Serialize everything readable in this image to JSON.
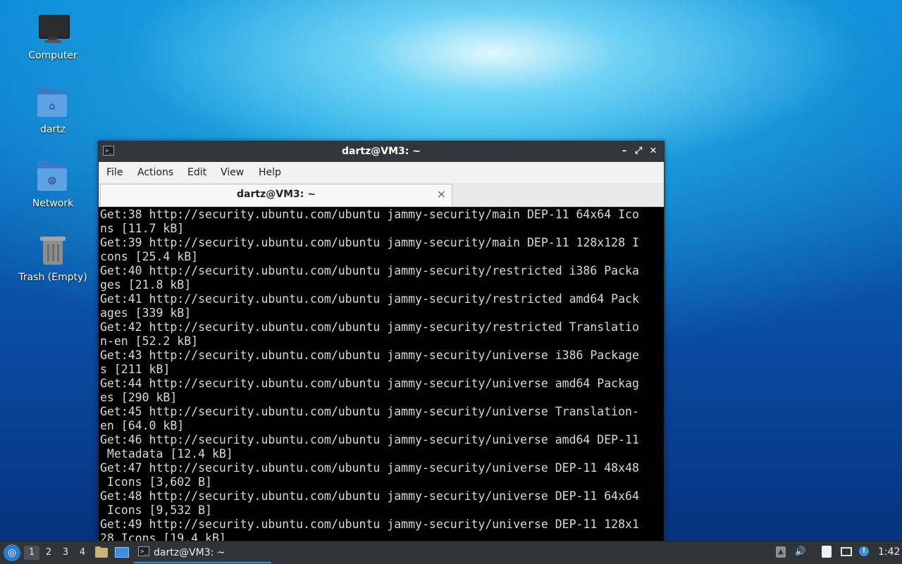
{
  "desktop": {
    "icons": [
      {
        "label": "Computer",
        "icon": "computer-icon"
      },
      {
        "label": "dartz",
        "icon": "home-folder-icon"
      },
      {
        "label": "Network",
        "icon": "network-folder-icon"
      },
      {
        "label": "Trash (Empty)",
        "icon": "trash-icon"
      }
    ]
  },
  "window": {
    "title": "dartz@VM3: ~",
    "buttons": {
      "minimize": "–",
      "maximize": "⤢",
      "close": "✕"
    },
    "menu": [
      "File",
      "Actions",
      "Edit",
      "View",
      "Help"
    ],
    "tab": {
      "label": "dartz@VM3: ~",
      "close": "×"
    },
    "terminal_lines": [
      "Get:38 http://security.ubuntu.com/ubuntu jammy-security/main DEP-11 64x64 Ico",
      "ns [11.7 kB]",
      "Get:39 http://security.ubuntu.com/ubuntu jammy-security/main DEP-11 128x128 I",
      "cons [25.4 kB]",
      "Get:40 http://security.ubuntu.com/ubuntu jammy-security/restricted i386 Packa",
      "ges [21.8 kB]",
      "Get:41 http://security.ubuntu.com/ubuntu jammy-security/restricted amd64 Pack",
      "ages [339 kB]",
      "Get:42 http://security.ubuntu.com/ubuntu jammy-security/restricted Translatio",
      "n-en [52.2 kB]",
      "Get:43 http://security.ubuntu.com/ubuntu jammy-security/universe i386 Package",
      "s [211 kB]",
      "Get:44 http://security.ubuntu.com/ubuntu jammy-security/universe amd64 Packag",
      "es [290 kB]",
      "Get:45 http://security.ubuntu.com/ubuntu jammy-security/universe Translation-",
      "en [64.0 kB]",
      "Get:46 http://security.ubuntu.com/ubuntu jammy-security/universe amd64 DEP-11",
      " Metadata [12.4 kB]",
      "Get:47 http://security.ubuntu.com/ubuntu jammy-security/universe DEP-11 48x48",
      " Icons [3,602 B]",
      "Get:48 http://security.ubuntu.com/ubuntu jammy-security/universe DEP-11 64x64",
      " Icons [9,532 B]",
      "Get:49 http://security.ubuntu.com/ubuntu jammy-security/universe DEP-11 128x1",
      "28 Icons [19.4 kB]"
    ]
  },
  "taskbar": {
    "workspaces": [
      "1",
      "2",
      "3",
      "4"
    ],
    "active_workspace": "1",
    "task_label": "dartz@VM3: ~",
    "clock": "1:42",
    "tray_icons": [
      "upload-icon",
      "volume-icon",
      "clipboard-icon",
      "network-icon",
      "update-notifier-icon"
    ]
  }
}
